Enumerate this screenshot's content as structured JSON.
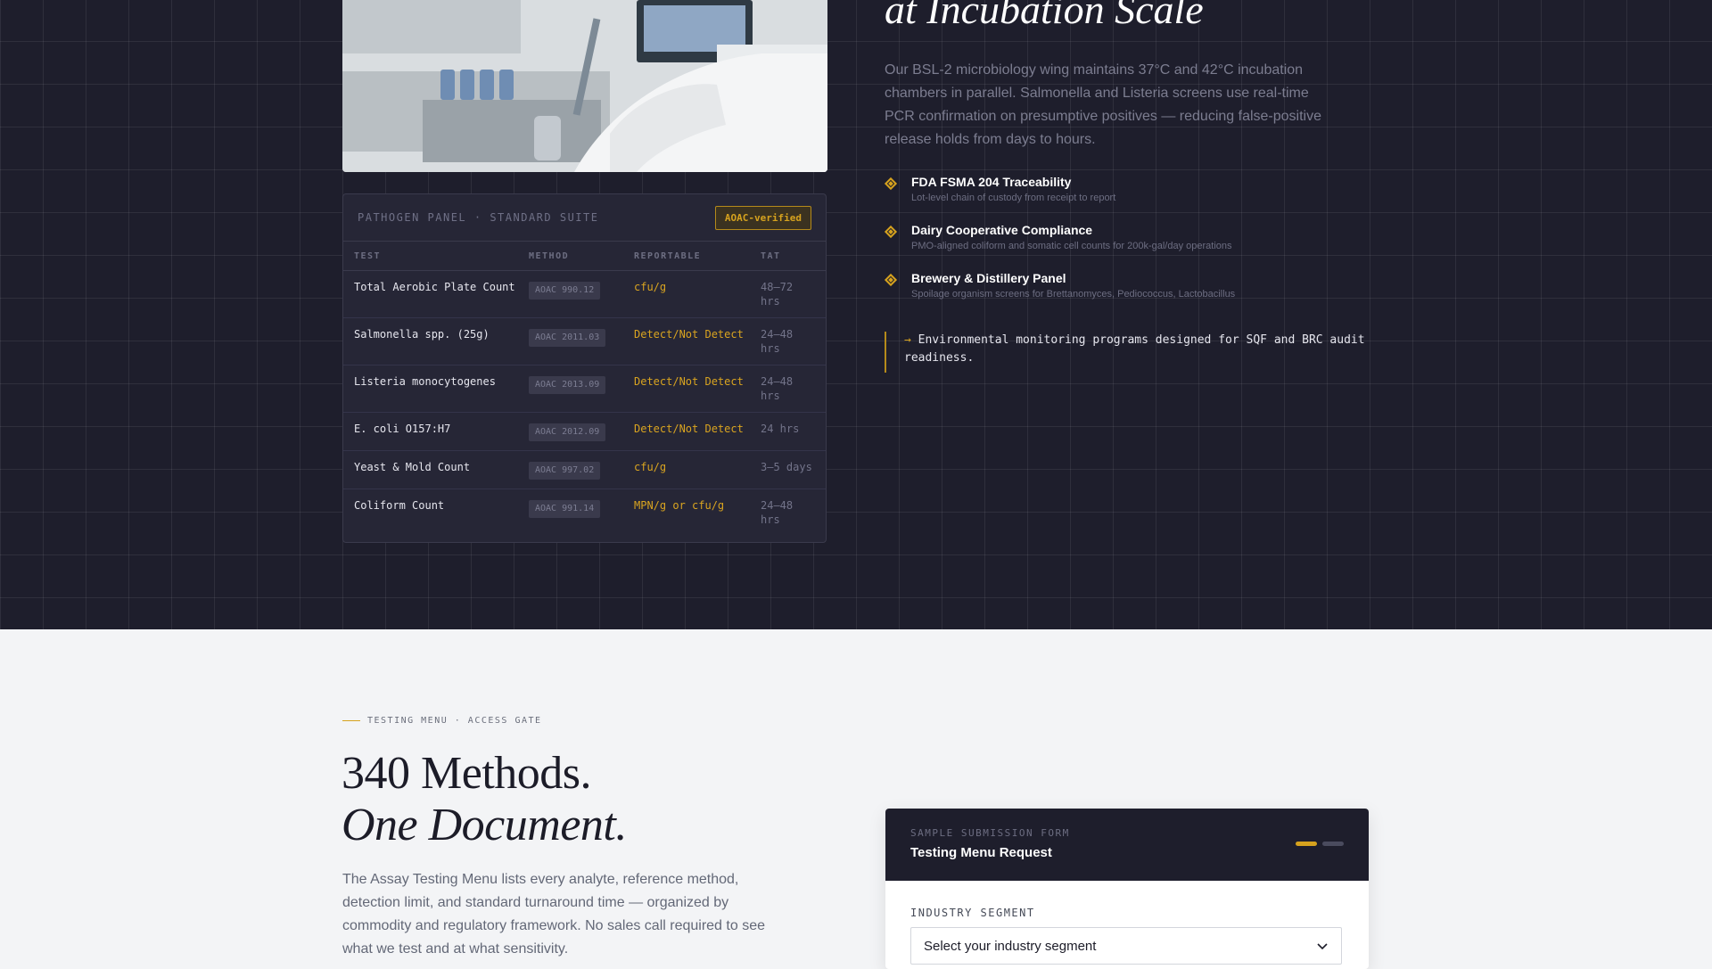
{
  "hero": {
    "headline": "at Incubation Scale",
    "paragraph": "Our BSL-2 microbiology wing maintains 37°C and 42°C incubation chambers in parallel. Salmonella and Listeria screens use real-time PCR confirmation on presumptive positives — reducing false-positive release holds from days to hours.",
    "features": [
      {
        "title": "FDA FSMA 204 Traceability",
        "desc": "Lot-level chain of custody from receipt to report"
      },
      {
        "title": "Dairy Cooperative Compliance",
        "desc": "PMO-aligned coliform and somatic cell counts for 200k-gal/day operations"
      },
      {
        "title": "Brewery & Distillery Panel",
        "desc": "Spoilage organism screens for Brettanomyces, Pediococcus, Lactobacillus"
      }
    ],
    "callout_arrow": "→",
    "callout": "Environmental monitoring programs designed for SQF and BRC audit readiness."
  },
  "panel": {
    "title": "PATHOGEN PANEL · STANDARD SUITE",
    "badge": "AOAC-verified",
    "columns": [
      "TEST",
      "METHOD",
      "REPORTABLE",
      "TAT"
    ],
    "rows": [
      {
        "test": "Total Aerobic Plate Count",
        "method": "AOAC 990.12",
        "reportable": "cfu/g",
        "tat": "48–72 hrs"
      },
      {
        "test": "Salmonella spp. (25g)",
        "method": "AOAC 2011.03",
        "reportable": "Detect/Not Detect",
        "tat": "24–48 hrs"
      },
      {
        "test": "Listeria monocytogenes",
        "method": "AOAC 2013.09",
        "reportable": "Detect/Not Detect",
        "tat": "24–48 hrs"
      },
      {
        "test": "E. coli O157:H7",
        "method": "AOAC 2012.09",
        "reportable": "Detect/Not Detect",
        "tat": "24 hrs"
      },
      {
        "test": "Yeast & Mold Count",
        "method": "AOAC 997.02",
        "reportable": "cfu/g",
        "tat": "3–5 days"
      },
      {
        "test": "Coliform Count",
        "method": "AOAC 991.14",
        "reportable": "MPN/g or cfu/g",
        "tat": "24–48 hrs"
      }
    ]
  },
  "menu": {
    "eyebrow": "TESTING MENU · ACCESS GATE",
    "heading_line1": "340 Methods.",
    "heading_line2": "One Document.",
    "paragraph": "The Assay Testing Menu lists every analyte, reference method, detection limit, and standard turnaround time — organized by commodity and regulatory framework. No sales call required to see what we test and at what sensitivity."
  },
  "form": {
    "kicker": "SAMPLE SUBMISSION FORM",
    "title": "Testing Menu Request",
    "progress_step": 1,
    "progress_total": 2,
    "field_label": "INDUSTRY SEGMENT",
    "select_value": "Select your industry segment"
  },
  "colors": {
    "accent": "#d6a21e",
    "dark_bg": "#1e1e2c",
    "light_bg": "#f3f4f6"
  }
}
